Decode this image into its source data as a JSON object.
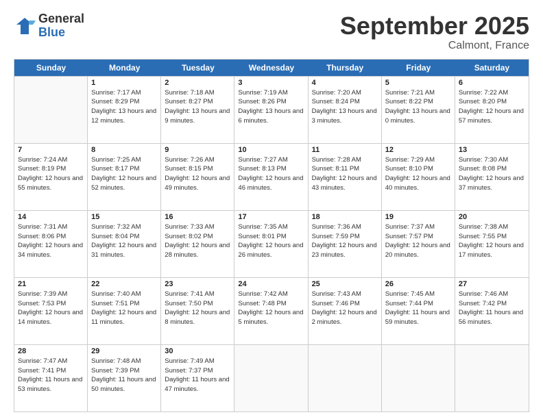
{
  "logo": {
    "general": "General",
    "blue": "Blue"
  },
  "title": {
    "month": "September 2025",
    "location": "Calmont, France"
  },
  "days_of_week": [
    "Sunday",
    "Monday",
    "Tuesday",
    "Wednesday",
    "Thursday",
    "Friday",
    "Saturday"
  ],
  "weeks": [
    [
      {
        "day": "",
        "sunrise": "",
        "sunset": "",
        "daylight": "",
        "empty": true
      },
      {
        "day": "1",
        "sunrise": "Sunrise: 7:17 AM",
        "sunset": "Sunset: 8:29 PM",
        "daylight": "Daylight: 13 hours and 12 minutes."
      },
      {
        "day": "2",
        "sunrise": "Sunrise: 7:18 AM",
        "sunset": "Sunset: 8:27 PM",
        "daylight": "Daylight: 13 hours and 9 minutes."
      },
      {
        "day": "3",
        "sunrise": "Sunrise: 7:19 AM",
        "sunset": "Sunset: 8:26 PM",
        "daylight": "Daylight: 13 hours and 6 minutes."
      },
      {
        "day": "4",
        "sunrise": "Sunrise: 7:20 AM",
        "sunset": "Sunset: 8:24 PM",
        "daylight": "Daylight: 13 hours and 3 minutes."
      },
      {
        "day": "5",
        "sunrise": "Sunrise: 7:21 AM",
        "sunset": "Sunset: 8:22 PM",
        "daylight": "Daylight: 13 hours and 0 minutes."
      },
      {
        "day": "6",
        "sunrise": "Sunrise: 7:22 AM",
        "sunset": "Sunset: 8:20 PM",
        "daylight": "Daylight: 12 hours and 57 minutes."
      }
    ],
    [
      {
        "day": "7",
        "sunrise": "Sunrise: 7:24 AM",
        "sunset": "Sunset: 8:19 PM",
        "daylight": "Daylight: 12 hours and 55 minutes."
      },
      {
        "day": "8",
        "sunrise": "Sunrise: 7:25 AM",
        "sunset": "Sunset: 8:17 PM",
        "daylight": "Daylight: 12 hours and 52 minutes."
      },
      {
        "day": "9",
        "sunrise": "Sunrise: 7:26 AM",
        "sunset": "Sunset: 8:15 PM",
        "daylight": "Daylight: 12 hours and 49 minutes."
      },
      {
        "day": "10",
        "sunrise": "Sunrise: 7:27 AM",
        "sunset": "Sunset: 8:13 PM",
        "daylight": "Daylight: 12 hours and 46 minutes."
      },
      {
        "day": "11",
        "sunrise": "Sunrise: 7:28 AM",
        "sunset": "Sunset: 8:11 PM",
        "daylight": "Daylight: 12 hours and 43 minutes."
      },
      {
        "day": "12",
        "sunrise": "Sunrise: 7:29 AM",
        "sunset": "Sunset: 8:10 PM",
        "daylight": "Daylight: 12 hours and 40 minutes."
      },
      {
        "day": "13",
        "sunrise": "Sunrise: 7:30 AM",
        "sunset": "Sunset: 8:08 PM",
        "daylight": "Daylight: 12 hours and 37 minutes."
      }
    ],
    [
      {
        "day": "14",
        "sunrise": "Sunrise: 7:31 AM",
        "sunset": "Sunset: 8:06 PM",
        "daylight": "Daylight: 12 hours and 34 minutes."
      },
      {
        "day": "15",
        "sunrise": "Sunrise: 7:32 AM",
        "sunset": "Sunset: 8:04 PM",
        "daylight": "Daylight: 12 hours and 31 minutes."
      },
      {
        "day": "16",
        "sunrise": "Sunrise: 7:33 AM",
        "sunset": "Sunset: 8:02 PM",
        "daylight": "Daylight: 12 hours and 28 minutes."
      },
      {
        "day": "17",
        "sunrise": "Sunrise: 7:35 AM",
        "sunset": "Sunset: 8:01 PM",
        "daylight": "Daylight: 12 hours and 26 minutes."
      },
      {
        "day": "18",
        "sunrise": "Sunrise: 7:36 AM",
        "sunset": "Sunset: 7:59 PM",
        "daylight": "Daylight: 12 hours and 23 minutes."
      },
      {
        "day": "19",
        "sunrise": "Sunrise: 7:37 AM",
        "sunset": "Sunset: 7:57 PM",
        "daylight": "Daylight: 12 hours and 20 minutes."
      },
      {
        "day": "20",
        "sunrise": "Sunrise: 7:38 AM",
        "sunset": "Sunset: 7:55 PM",
        "daylight": "Daylight: 12 hours and 17 minutes."
      }
    ],
    [
      {
        "day": "21",
        "sunrise": "Sunrise: 7:39 AM",
        "sunset": "Sunset: 7:53 PM",
        "daylight": "Daylight: 12 hours and 14 minutes."
      },
      {
        "day": "22",
        "sunrise": "Sunrise: 7:40 AM",
        "sunset": "Sunset: 7:51 PM",
        "daylight": "Daylight: 12 hours and 11 minutes."
      },
      {
        "day": "23",
        "sunrise": "Sunrise: 7:41 AM",
        "sunset": "Sunset: 7:50 PM",
        "daylight": "Daylight: 12 hours and 8 minutes."
      },
      {
        "day": "24",
        "sunrise": "Sunrise: 7:42 AM",
        "sunset": "Sunset: 7:48 PM",
        "daylight": "Daylight: 12 hours and 5 minutes."
      },
      {
        "day": "25",
        "sunrise": "Sunrise: 7:43 AM",
        "sunset": "Sunset: 7:46 PM",
        "daylight": "Daylight: 12 hours and 2 minutes."
      },
      {
        "day": "26",
        "sunrise": "Sunrise: 7:45 AM",
        "sunset": "Sunset: 7:44 PM",
        "daylight": "Daylight: 11 hours and 59 minutes."
      },
      {
        "day": "27",
        "sunrise": "Sunrise: 7:46 AM",
        "sunset": "Sunset: 7:42 PM",
        "daylight": "Daylight: 11 hours and 56 minutes."
      }
    ],
    [
      {
        "day": "28",
        "sunrise": "Sunrise: 7:47 AM",
        "sunset": "Sunset: 7:41 PM",
        "daylight": "Daylight: 11 hours and 53 minutes."
      },
      {
        "day": "29",
        "sunrise": "Sunrise: 7:48 AM",
        "sunset": "Sunset: 7:39 PM",
        "daylight": "Daylight: 11 hours and 50 minutes."
      },
      {
        "day": "30",
        "sunrise": "Sunrise: 7:49 AM",
        "sunset": "Sunset: 7:37 PM",
        "daylight": "Daylight: 11 hours and 47 minutes."
      },
      {
        "day": "",
        "sunrise": "",
        "sunset": "",
        "daylight": "",
        "empty": true
      },
      {
        "day": "",
        "sunrise": "",
        "sunset": "",
        "daylight": "",
        "empty": true
      },
      {
        "day": "",
        "sunrise": "",
        "sunset": "",
        "daylight": "",
        "empty": true
      },
      {
        "day": "",
        "sunrise": "",
        "sunset": "",
        "daylight": "",
        "empty": true
      }
    ]
  ]
}
